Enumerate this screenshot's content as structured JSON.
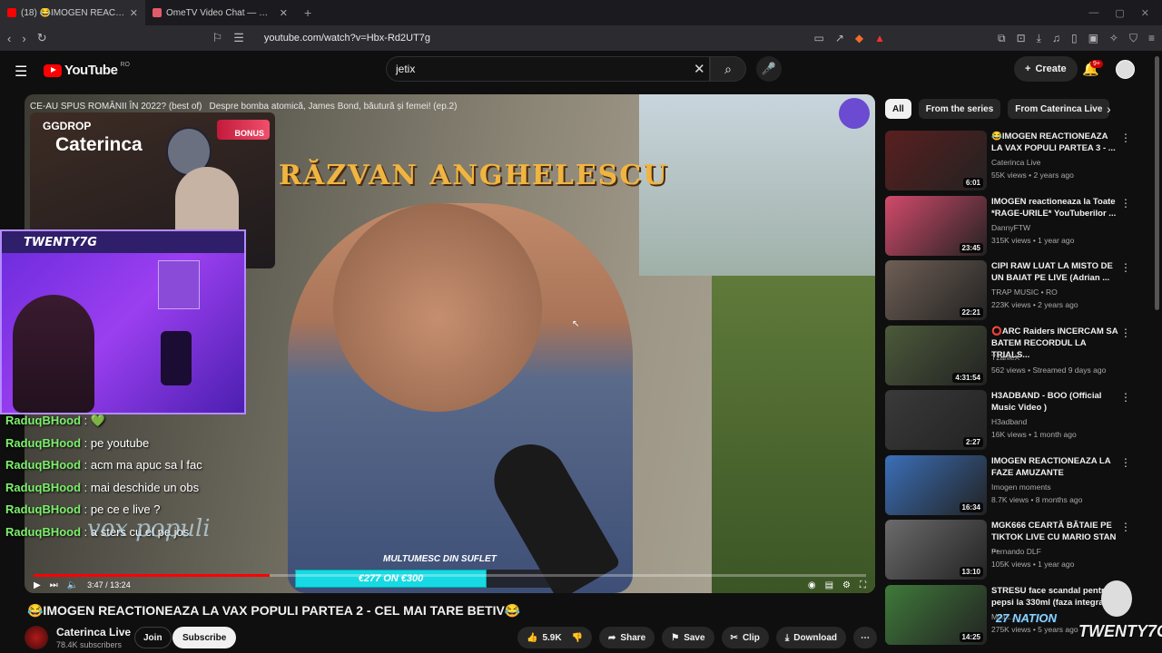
{
  "browser": {
    "tabs": [
      {
        "title": "(18) 😂IMOGEN REACTIONE...",
        "active": true
      },
      {
        "title": "OmeTV Video Chat — Omegle R...",
        "active": false
      }
    ],
    "new_tab": "+",
    "url": "youtube.com/watch?v=Hbx-Rd2UT7g"
  },
  "youtube": {
    "logo": "YouTube",
    "country": "RO",
    "search_value": "jetix",
    "create_label": "Create",
    "notifications": "9+"
  },
  "video": {
    "top_title_1": "CE-AU SPUS ROMÂNII ÎN 2022? (best of)",
    "top_title_2": "Despre bomba atomică, James Bond, băutură și femei! (ep.2)",
    "banner_name": "RĂZVAN ANGHELESCU",
    "cam1_brand": "GGDROP",
    "cam1_name": "Caterinca",
    "cam1_bonus": "BONUS",
    "cam2_name": "TWENTY7G",
    "vox_text": "vox populi",
    "multumesc": "MULTUMESC DIN SUFLET",
    "gift": "€277 ON €300",
    "time": "3:47 / 13:24",
    "progress": 0.283
  },
  "chat": [
    {
      "user": "RaduqBHood",
      "msg": "💚"
    },
    {
      "user": "RaduqBHood",
      "msg": "pe youtube"
    },
    {
      "user": "RaduqBHood",
      "msg": "acm ma apuc sa l fac"
    },
    {
      "user": "RaduqBHood",
      "msg": "mai deschide un obs"
    },
    {
      "user": "RaduqBHood",
      "msg": "pe ce e live ?"
    },
    {
      "user": "RaduqBHood",
      "msg": "a sters cu el pe jos"
    }
  ],
  "watch": {
    "title": "😂IMOGEN REACTIONEAZA LA VAX POPULI PARTEA 2 - CEL MAI TARE BETIV😂",
    "channel": "Caterinca Live",
    "subscribers": "78.4K subscribers",
    "join": "Join",
    "subscribe": "Subscribe",
    "likes": "5.9K",
    "share": "Share",
    "save": "Save",
    "clip": "Clip",
    "download": "Download"
  },
  "chips": [
    "All",
    "From the series",
    "From Caterinca Live"
  ],
  "recommendations": [
    {
      "title": "😂IMOGEN REACTIONEAZA LA VAX POPULI PARTEA 3 - ...",
      "channel": "Caterinca Live",
      "meta": "55K views • 2 years ago",
      "duration": "6:01",
      "color": "#5a1f1f"
    },
    {
      "title": "IMOGEN reactioneaza la Toate *RAGE-URILE* YouTuberilor ...",
      "channel": "DannyFTW",
      "meta": "315K views • 1 year ago",
      "duration": "23:45",
      "color": "#d24a6b"
    },
    {
      "title": "CIPI RAW LUAT LA MISTO DE UN BAIAT PE LIVE (Adrian ...",
      "channel": "TRAP MUSIC • RO",
      "meta": "223K views • 2 years ago",
      "duration": "22:21",
      "color": "#6f5f55"
    },
    {
      "title": "⭕ARC Raiders INCERCAM SA BATEM RECORDUL LA TRIALS...",
      "channel": "TzanleX",
      "meta": "562 views • Streamed 9 days ago",
      "duration": "4:31:54",
      "color": "#4c5a3a"
    },
    {
      "title": "H3ADBAND - BOO (Official Music Video )",
      "channel": "H3adband",
      "meta": "16K views • 1 month ago",
      "duration": "2:27",
      "color": "#3a3a3a"
    },
    {
      "title": "IMOGEN REACTIONEAZA LA FAZE AMUZANTE",
      "channel": "Imogen moments",
      "meta": "8.7K views • 8 months ago",
      "duration": "16:34",
      "color": "#3b6fb8"
    },
    {
      "title": "MGK666 CEARTĂ BĂTAIE PE TIKTOK LIVE CU MARIO STAN ...",
      "channel": "Fernando DLF",
      "meta": "105K views • 1 year ago",
      "duration": "13:10",
      "color": "#6b6b6b"
    },
    {
      "title": "STRESU face scandal pentru pepsi la 330ml (faza integrală...",
      "channel": "Michi...",
      "meta": "275K views • 5 years ago",
      "duration": "14:25",
      "color": "#3f7a3a"
    }
  ],
  "overlay": {
    "brand": "27 NATION",
    "brand2": "TWENTY7G"
  },
  "icons": [
    "search-icon",
    "mic-icon",
    "bell-icon",
    "menu-icon",
    "close-icon",
    "like-icon",
    "dislike-icon",
    "share-icon",
    "save-icon",
    "clip-icon",
    "download-icon",
    "more-icon"
  ]
}
